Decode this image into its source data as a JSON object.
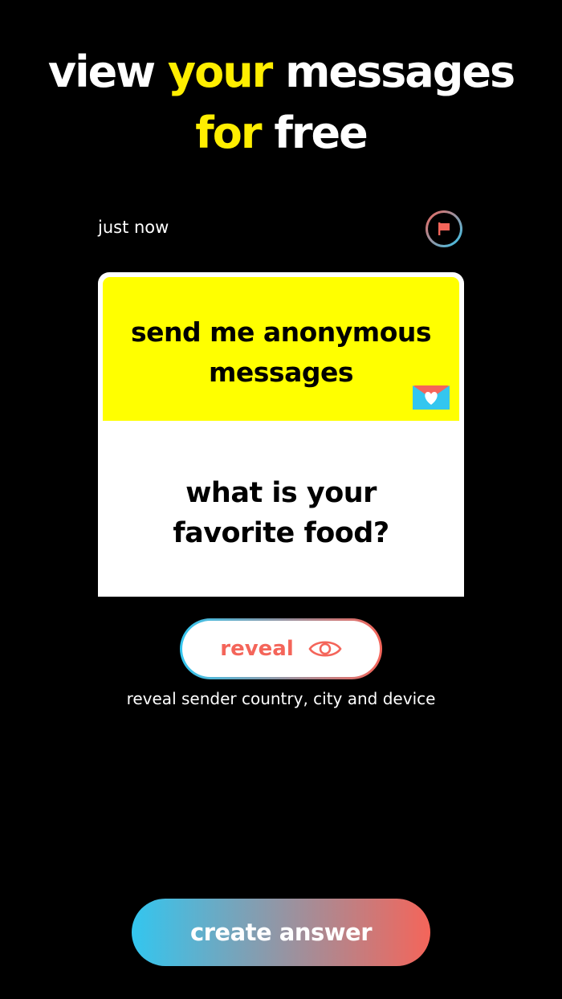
{
  "headline": {
    "line1_part1": "view ",
    "line1_highlight": "your",
    "line1_part2": " messages",
    "line2_highlight": "for",
    "line2_part2": " free"
  },
  "message": {
    "timestamp": "just now",
    "report_icon": "flag-icon",
    "prompt": "send me anonymous messages",
    "prompt_icon": "heart-envelope-icon",
    "question_line1": "what is your",
    "question_line2": "favorite food?"
  },
  "reveal": {
    "label": "reveal",
    "icon": "eye-icon",
    "hint": "reveal sender country, city and device"
  },
  "create_answer": {
    "label": "create answer"
  },
  "colors": {
    "background": "#000000",
    "highlight": "#ffee00",
    "card_top": "#ffff00",
    "accent_coral": "#f4655a",
    "accent_cyan": "#33c6ef"
  }
}
